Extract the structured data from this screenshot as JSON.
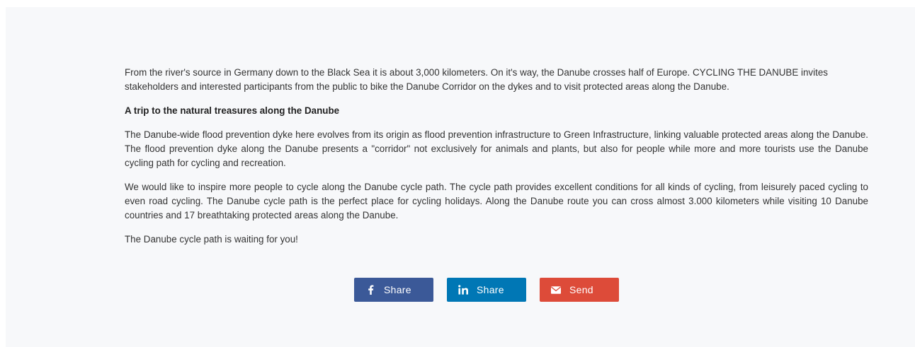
{
  "article": {
    "paragraph_1": "From the river's source in Germany down to the Black Sea it is about 3,000 kilometers. On it's way, the Danube crosses half of Europe. CYCLING THE DANUBE invites stakeholders and interested participants from the public to bike the Danube Corridor on the dykes and to visit protected areas along the Danube.",
    "subheading": "A trip to the natural treasures along the Danube",
    "paragraph_2": "The Danube-wide flood prevention dyke here evolves from its origin as flood prevention infrastructure to Green Infrastructure, linking valuable protected areas along the Danube. The flood prevention dyke along the Danube presents a \"corridor\" not exclusively for animals and plants, but also for people while more and more tourists use the Danube cycling path for cycling and recreation.",
    "paragraph_3": "We would like to inspire more people to cycle along the Danube cycle path. The cycle path provides excellent conditions for all kinds of cycling, from leisurely paced cycling to even road cycling. The Danube cycle path is the perfect place for cycling holidays. Along the Danube route you can cross almost 3.000 kilometers while visiting 10 Danube countries and 17 breathtaking protected areas along the Danube.",
    "closing": "The Danube cycle path is waiting for you!"
  },
  "share": {
    "facebook": {
      "label": "Share",
      "icon": "facebook-icon",
      "color": "#3b5998"
    },
    "linkedin": {
      "label": "Share",
      "icon": "linkedin-icon",
      "color": "#0077b5"
    },
    "email": {
      "label": "Send",
      "icon": "envelope-icon",
      "color": "#dd4b39"
    }
  },
  "colors": {
    "page_background": "#ffffff",
    "panel_background": "#f7f8fa",
    "text": "#333333"
  }
}
